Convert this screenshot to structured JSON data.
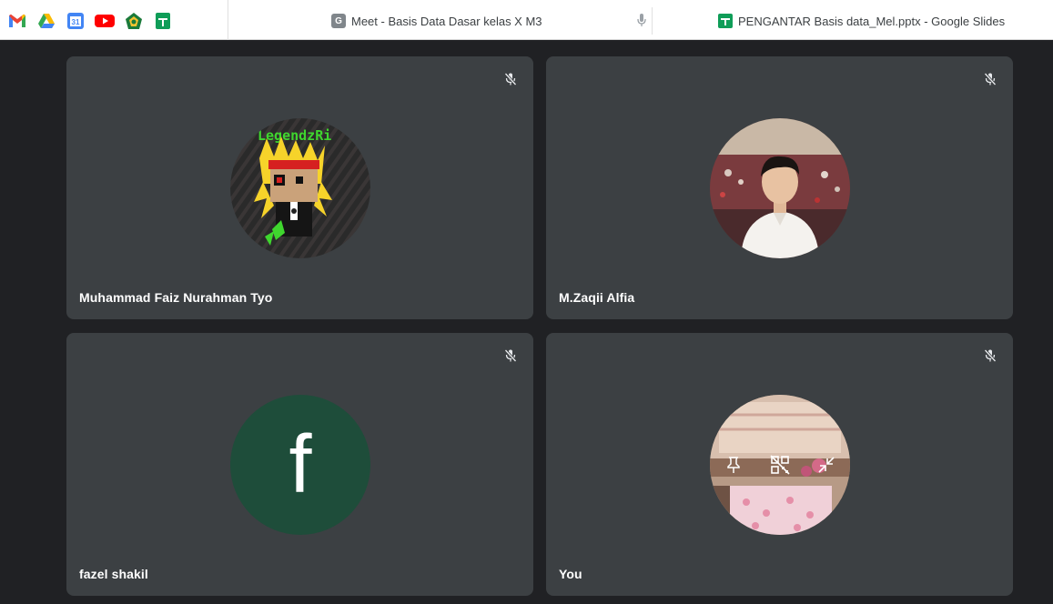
{
  "browser": {
    "bookmarks": [
      {
        "icon": "gmail-icon"
      },
      {
        "icon": "google-drive-icon"
      },
      {
        "icon": "google-calendar-icon",
        "text": "31"
      },
      {
        "icon": "youtube-icon"
      },
      {
        "icon": "school-emblem-icon"
      },
      {
        "icon": "google-slides-icon"
      }
    ],
    "tabs": [
      {
        "title": "Meet - Basis Data Dasar kelas X M3",
        "favicon_text": "G",
        "active": false
      },
      {
        "title": "PENGANTAR Basis data_Mel.pptx - Google Slides",
        "active": true
      }
    ]
  },
  "meeting": {
    "participants": [
      {
        "name": "Muhammad Faiz Nurahman Tyo",
        "avatar_type": "image",
        "avatar_text": "LegendzRi",
        "muted": true
      },
      {
        "name": "M.Zaqii Alfia",
        "avatar_type": "photo",
        "muted": true
      },
      {
        "name": "fazel shakil",
        "avatar_type": "letter",
        "avatar_letter": "f",
        "avatar_color": "#1e4d3a",
        "muted": true
      },
      {
        "name": "You",
        "avatar_type": "photo",
        "muted": true,
        "hover_controls": [
          "pin-icon",
          "remove-tile-icon",
          "minimize-icon"
        ]
      }
    ]
  },
  "colors": {
    "background": "#202124",
    "tile": "#3c4043",
    "text": "#ffffff"
  }
}
